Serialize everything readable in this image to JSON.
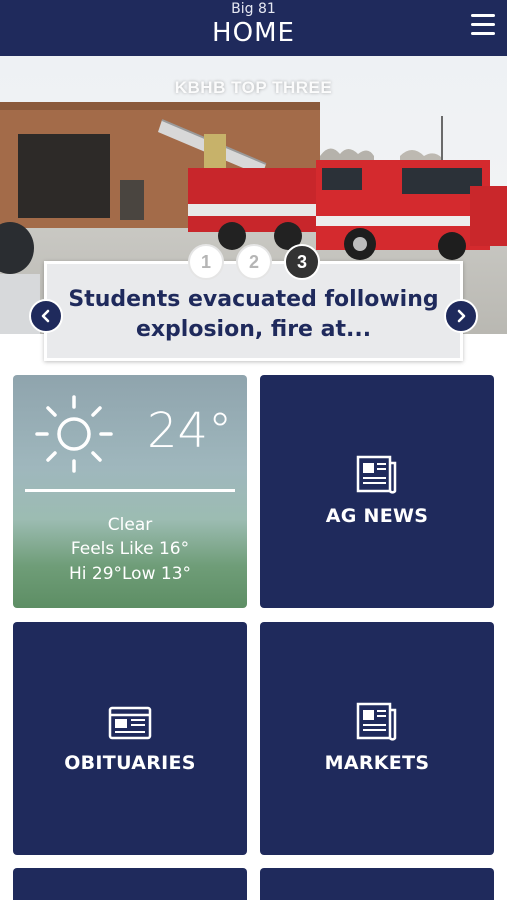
{
  "header": {
    "station": "Big 81",
    "title": "HOME",
    "menu_icon": "hamburger-menu-icon"
  },
  "carousel": {
    "label": "KBHB TOP THREE",
    "headline": "Students evacuated following explosion, fire at...",
    "pages": [
      "1",
      "2",
      "3"
    ],
    "active_page": 3,
    "prev_icon": "chevron-left-icon",
    "next_icon": "chevron-right-icon"
  },
  "weather": {
    "icon": "sun-icon",
    "temperature": "24°",
    "condition": "Clear",
    "feels_like": "Feels Like 16°",
    "hi_low": "Hi 29°Low 13°"
  },
  "tiles": [
    {
      "label": "AG NEWS",
      "icon": "newspaper-icon"
    },
    {
      "label": "OBITUARIES",
      "icon": "newspaper-icon"
    },
    {
      "label": "MARKETS",
      "icon": "newspaper-icon"
    }
  ],
  "colors": {
    "brand_navy": "#1f2a5c",
    "active_dot": "#333333",
    "background": "#ffffff"
  }
}
